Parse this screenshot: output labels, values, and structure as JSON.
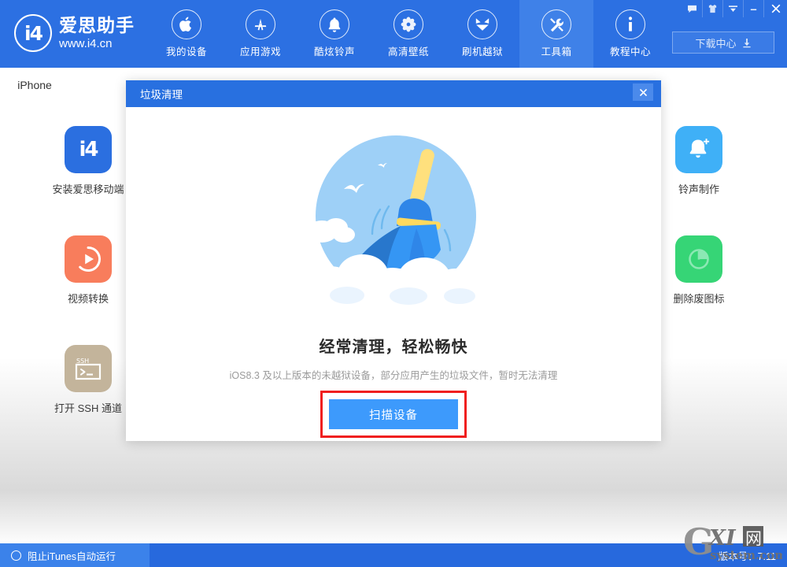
{
  "window": {
    "controls": [
      {
        "name": "feedback-icon",
        "glyph": "⌨"
      },
      {
        "name": "skin-icon",
        "glyph": " "
      },
      {
        "name": "menu-icon",
        "glyph": " "
      },
      {
        "name": "minimize-icon",
        "glyph": "–"
      },
      {
        "name": "close-icon",
        "glyph": "✕"
      }
    ]
  },
  "header": {
    "logo_mark": "i4",
    "logo_title": "爱思助手",
    "logo_sub": "www.i4.cn",
    "nav": [
      {
        "label": "我的设备",
        "icon": "apple-icon",
        "active": false
      },
      {
        "label": "应用游戏",
        "icon": "appstore-icon",
        "active": false
      },
      {
        "label": "酷炫铃声",
        "icon": "bell-icon",
        "active": false
      },
      {
        "label": "高清壁纸",
        "icon": "flower-icon",
        "active": false
      },
      {
        "label": "刷机越狱",
        "icon": "box-icon",
        "active": false
      },
      {
        "label": "工具箱",
        "icon": "tools-icon",
        "active": true
      },
      {
        "label": "教程中心",
        "icon": "info-icon",
        "active": false
      }
    ],
    "download_label": "下载中心",
    "download_icon": "download-icon"
  },
  "tabs": {
    "items": [
      {
        "label": "iPhone",
        "active": true
      }
    ]
  },
  "tools": {
    "left": [
      {
        "label": "安装爱思移动端",
        "icon": "i4-app-icon",
        "color": "#2b6fe0"
      },
      {
        "label": "视频转换",
        "icon": "video-convert-icon",
        "color": "#f87d5c"
      },
      {
        "label": "打开 SSH 通道",
        "icon": "ssh-terminal-icon",
        "color": "#c3b49b"
      }
    ],
    "right": [
      {
        "label": "铃声制作",
        "icon": "ringtone-icon",
        "color": "#3fb0f7"
      },
      {
        "label": "删除废图标",
        "icon": "delete-icon-icon",
        "color": "#36d576"
      }
    ]
  },
  "dialog": {
    "title": "垃圾清理",
    "close_icon": "close-icon",
    "illustration": "broom-cleaning-illustration",
    "heading": "经常清理，轻松畅快",
    "subtext": "iOS8.3 及以上版本的未越狱设备，部分应用产生的垃圾文件，暂时无法清理",
    "scan_button": "扫描设备",
    "highlight_color": "#f01f1f"
  },
  "statusbar": {
    "toggle_label": "阻止iTunes自动运行",
    "toggle_icon": "circle-toggle-icon",
    "version": "版本号：7.11"
  },
  "watermark": {
    "main": "GXI",
    "cn": "网",
    "sub": "system.com"
  },
  "colors": {
    "header_blue": "#2c70e2",
    "dialog_blue": "#2870e0",
    "button_blue": "#3d9afc",
    "status_blue": "#2769dd"
  }
}
